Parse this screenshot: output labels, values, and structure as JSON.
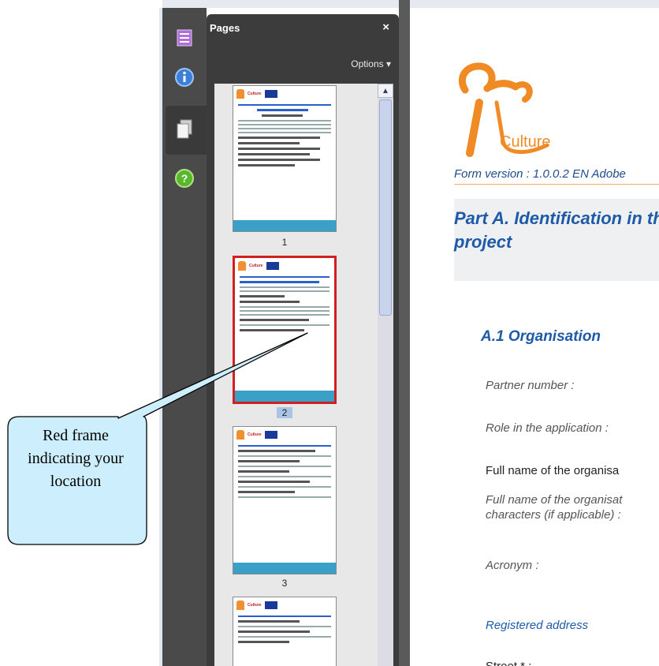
{
  "sidebar_panel": {
    "title": "Pages",
    "close_glyph": "×",
    "options_label": "Options ▾"
  },
  "rail_icons": [
    "layers-icon",
    "info-icon",
    "pages-icon",
    "help-icon"
  ],
  "thumbnails": [
    {
      "page": "1",
      "selected": false
    },
    {
      "page": "2",
      "selected": true
    },
    {
      "page": "3",
      "selected": false
    }
  ],
  "document": {
    "logo_text": "Culture",
    "form_version": "Form version : 1.0.0.2 EN  Adobe",
    "part_title": "Part A. Identification in the project",
    "section_title": "A.1 Organisation",
    "fields": [
      "Partner number :",
      "Role in the application :",
      "Full name of the organisa",
      "Full name of the organisat characters (if applicable) :",
      "Acronym :",
      "Registered address",
      "Street * :"
    ]
  },
  "callout": {
    "text": "Red frame indicating your location"
  },
  "colors": {
    "selection_frame": "#d22020",
    "heading_blue": "#1e5aa8",
    "logo_orange": "#f08a24"
  }
}
